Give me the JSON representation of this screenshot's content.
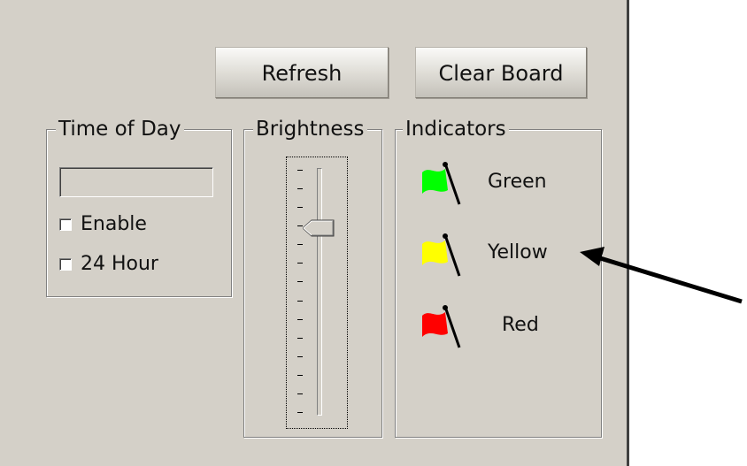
{
  "buttons": {
    "refresh_label": "Refresh",
    "clear_board_label": "Clear Board"
  },
  "time_of_day": {
    "title": "Time of Day",
    "time_value": "",
    "enable": {
      "label": "Enable",
      "checked": false
    },
    "hour24": {
      "label": "24 Hour",
      "checked": false
    }
  },
  "brightness": {
    "title": "Brightness",
    "level_fraction": 0.76,
    "tick_count": 14
  },
  "indicators": {
    "title": "Indicators",
    "items": [
      {
        "label": "Green",
        "color": "#00ff00",
        "icon": "green-flag-icon"
      },
      {
        "label": "Yellow",
        "color": "#ffff00",
        "icon": "yellow-flag-icon"
      },
      {
        "label": "Red",
        "color": "#ff0000",
        "icon": "red-flag-icon"
      }
    ]
  },
  "annotation": {
    "icon": "pointer-arrow-icon",
    "color": "#000000"
  }
}
